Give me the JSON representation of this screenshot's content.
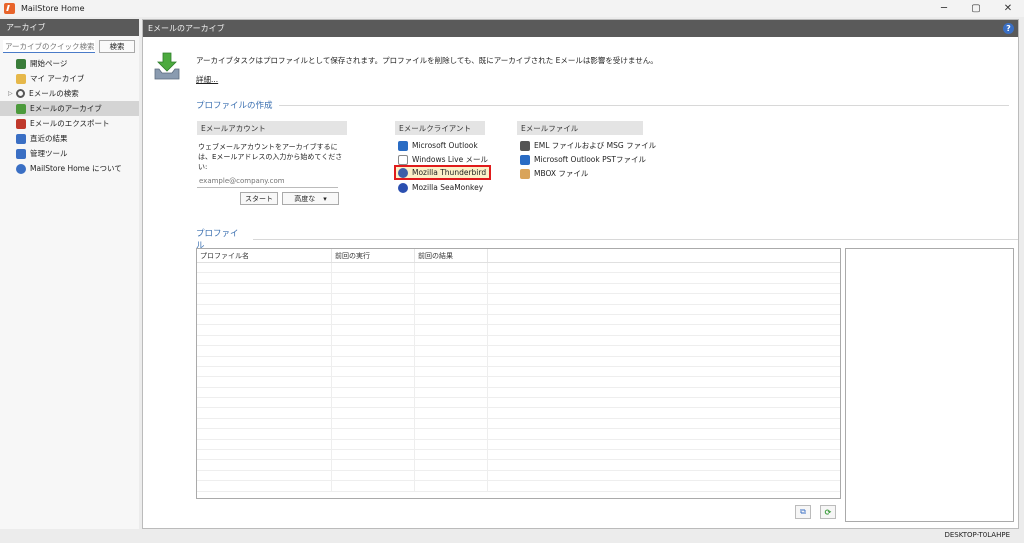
{
  "window": {
    "title": "MailStore Home",
    "controls": [
      "─",
      "▢",
      "✕"
    ]
  },
  "left_panel": {
    "header": "アーカイブ",
    "search": {
      "placeholder": "アーカイブのクイック検索",
      "button_label": "検索"
    },
    "nav": [
      {
        "label": "開始ページ",
        "icon": "start-page-icon",
        "color": "#3a7d3a"
      },
      {
        "label": "マイ アーカイブ",
        "icon": "folder-icon",
        "color": "#e6b84a"
      },
      {
        "label": "Eメールの検索",
        "icon": "search-icon",
        "color": "#555555"
      },
      {
        "label": "Eメールのアーカイブ",
        "icon": "archive-icon",
        "color": "#4c9a3c"
      },
      {
        "label": "Eメールのエクスポート",
        "icon": "export-icon",
        "color": "#c0392b"
      },
      {
        "label": "直近の結果",
        "icon": "recent-results-icon",
        "color": "#3a6fc4"
      },
      {
        "label": "管理ツール",
        "icon": "admin-tools-icon",
        "color": "#3a6fc4"
      },
      {
        "label": "MailStore Home について",
        "icon": "info-icon",
        "color": "#3a6fc4"
      }
    ]
  },
  "main": {
    "header": "Eメールのアーカイブ",
    "help_glyph": "?",
    "intro_text": "アーカイブタスクはプロファイルとして保存されます。プロファイルを削除しても、既にアーカイブされた Eメールは影響を受けません。",
    "details_link": "詳細...",
    "create_profile_title": "プロファイルの作成",
    "email_account": {
      "header": "Eメールアカウント",
      "help_text": "ウェブメールアカウントをアーカイブするには、Eメールアドレスの入力から始めてください:",
      "email_placeholder": "example@company.com",
      "start_button": "スタート",
      "advanced_button": "高度な",
      "advanced_arrow": "▾"
    },
    "email_client": {
      "header": "Eメールクライアント",
      "items": [
        {
          "label": "Microsoft Outlook",
          "icon": "outlook-icon",
          "color": "#2a6cc4"
        },
        {
          "label": "Windows Live メール",
          "icon": "windows-live-mail-icon",
          "color": "#8a8a8a"
        },
        {
          "label": "Mozilla Thunderbird",
          "icon": "thunderbird-icon",
          "color": "#3d5fa8"
        },
        {
          "label": "Mozilla SeaMonkey",
          "icon": "seamonkey-icon",
          "color": "#2b4fb0"
        }
      ]
    },
    "email_file": {
      "header": "Eメールファイル",
      "items": [
        {
          "label": "EML ファイルおよび MSG ファイル",
          "icon": "eml-msg-icon",
          "color": "#555555"
        },
        {
          "label": "Microsoft Outlook PSTファイル",
          "icon": "outlook-pst-icon",
          "color": "#2a6cc4"
        },
        {
          "label": "MBOX ファイル",
          "icon": "mbox-icon",
          "color": "#d9a45a"
        }
      ]
    },
    "profiles_title": "プロファイル",
    "profiles_table": {
      "columns": [
        "プロファイル名",
        "前回の実行",
        "前回の結果",
        ""
      ]
    },
    "tools": {
      "copy_icon": "⧉",
      "refresh_icon": "⟳"
    }
  },
  "status_bar": {
    "machine": "DESKTOP-T0LAHPE"
  },
  "colors": {
    "accent_blue": "#3a6fb0",
    "header_gray": "#5a5a5a",
    "highlight_red": "#e01b1b"
  }
}
